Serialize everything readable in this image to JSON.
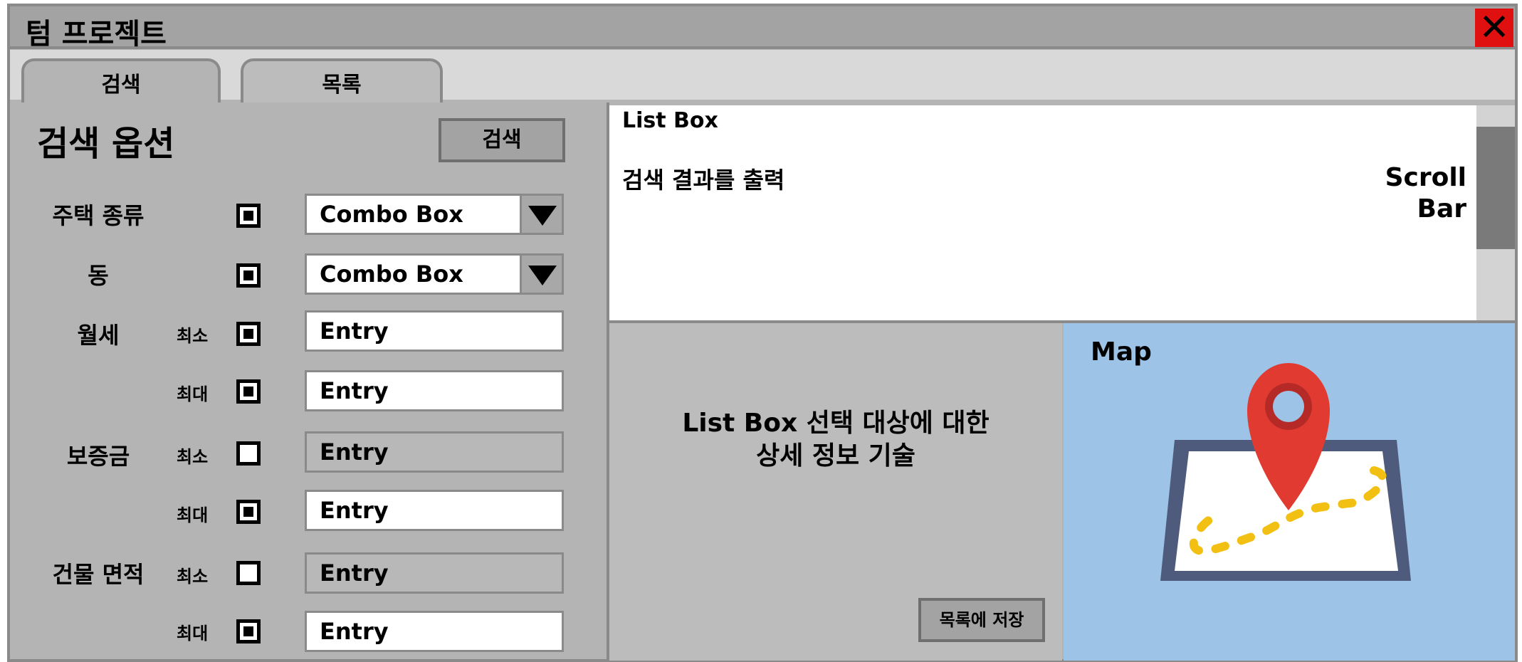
{
  "window": {
    "title": "텀 프로젝트",
    "close_glyph": "✕"
  },
  "tabs": [
    {
      "label": "검색",
      "active": true
    },
    {
      "label": "목록",
      "active": false
    }
  ],
  "search_panel": {
    "heading": "검색 옵션",
    "search_button": "검색",
    "rows": [
      {
        "label": "주택 종류",
        "sub": "",
        "checked": true,
        "control": "combo",
        "value": "Combo Box",
        "enabled": true
      },
      {
        "label": "동",
        "sub": "",
        "checked": true,
        "control": "combo",
        "value": "Combo Box",
        "enabled": true
      },
      {
        "label": "월세",
        "sub": "최소",
        "checked": true,
        "control": "entry",
        "value": "Entry",
        "enabled": true
      },
      {
        "label": "",
        "sub": "최대",
        "checked": true,
        "control": "entry",
        "value": "Entry",
        "enabled": true
      },
      {
        "label": "보증금",
        "sub": "최소",
        "checked": false,
        "control": "entry",
        "value": "Entry",
        "enabled": false
      },
      {
        "label": "",
        "sub": "최대",
        "checked": true,
        "control": "entry",
        "value": "Entry",
        "enabled": true
      },
      {
        "label": "건물 면적",
        "sub": "최소",
        "checked": false,
        "control": "entry",
        "value": "Entry",
        "enabled": false
      },
      {
        "label": "",
        "sub": "최대",
        "checked": true,
        "control": "entry",
        "value": "Entry",
        "enabled": true
      }
    ]
  },
  "results": {
    "title": "List Box",
    "text": "검색 결과를 출력",
    "scrollbar_label_1": "Scroll",
    "scrollbar_label_2": "Bar"
  },
  "detail": {
    "line1": "List Box 선택 대상에 대한",
    "line2": "상세 정보 기술",
    "save_button": "목록에 저장"
  },
  "map": {
    "label": "Map",
    "icon": "map-pin-icon",
    "colors": {
      "background": "#9dc3e6",
      "pin": "#e03a31",
      "route": "#f2c012",
      "frame": "#4f5b7c"
    }
  }
}
